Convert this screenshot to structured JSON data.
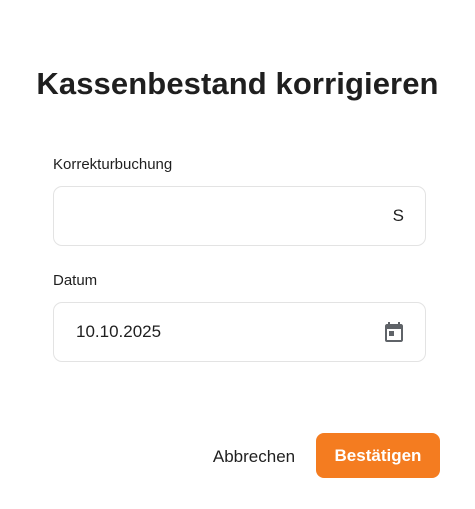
{
  "dialog": {
    "title": "Kassenbestand korrigieren"
  },
  "fields": {
    "korrektur": {
      "label": "Korrekturbuchung",
      "value": "",
      "placeholder": "",
      "suffix": "S"
    },
    "datum": {
      "label": "Datum",
      "value": "10.10.2025",
      "icon": "calendar-icon"
    }
  },
  "actions": {
    "cancel_label": "Abbrechen",
    "confirm_label": "Bestätigen"
  },
  "colors": {
    "accent": "#f47c20",
    "icon_gray": "#5f6368"
  }
}
